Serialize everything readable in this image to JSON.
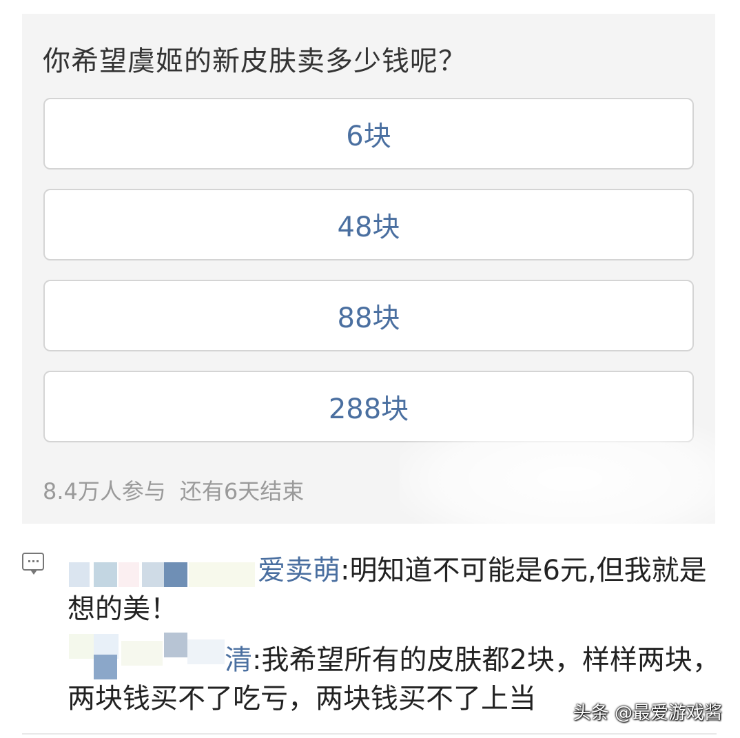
{
  "poll": {
    "question": "你希望虞姬的新皮肤卖多少钱呢？",
    "options": [
      {
        "label": "6块"
      },
      {
        "label": "48块"
      },
      {
        "label": "88块"
      },
      {
        "label": "288块"
      }
    ],
    "participants": "8.4万人参与",
    "remaining": "还有6天结束"
  },
  "comments": [
    {
      "user": "爱卖萌",
      "text": ":明知道不可能是6元,但我就是想的美！"
    },
    {
      "user": "清",
      "text": ":我希望所有的皮肤都2块，样样两块，两块钱买不了吃亏，两块钱买不了上当"
    }
  ],
  "watermark": "头条 @最爱游戏酱",
  "icons": {
    "comment": "comment-bubble-icon"
  }
}
